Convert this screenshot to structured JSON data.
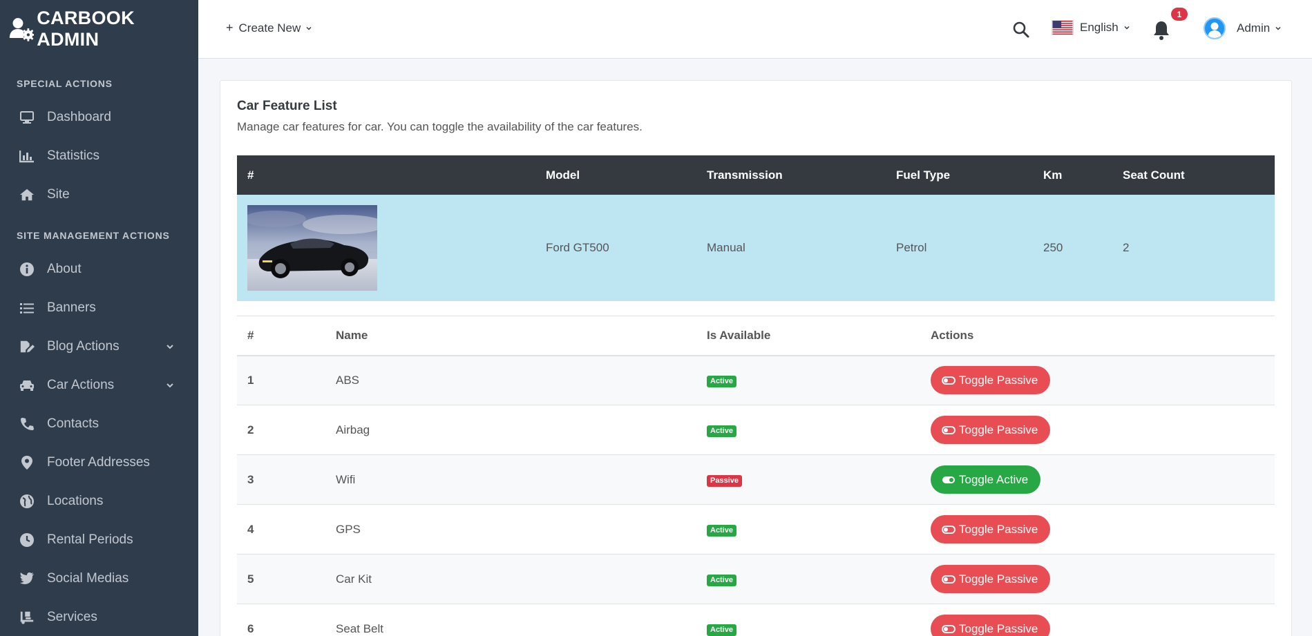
{
  "brand": {
    "title": "CARBOOK ADMIN"
  },
  "sidebar": {
    "sections": [
      {
        "header": "SPECIAL ACTIONS",
        "items": [
          {
            "label": "Dashboard",
            "icon": "desktop-icon"
          },
          {
            "label": "Statistics",
            "icon": "bar-chart-icon"
          },
          {
            "label": "Site",
            "icon": "home-icon"
          }
        ]
      },
      {
        "header": "SITE MANAGEMENT ACTIONS",
        "items": [
          {
            "label": "About",
            "icon": "info-icon"
          },
          {
            "label": "Banners",
            "icon": "list-icon"
          },
          {
            "label": "Blog Actions",
            "icon": "edit-icon",
            "expandable": true
          },
          {
            "label": "Car Actions",
            "icon": "car-icon",
            "expandable": true
          },
          {
            "label": "Contacts",
            "icon": "phone-icon"
          },
          {
            "label": "Footer Addresses",
            "icon": "map-marker-icon"
          },
          {
            "label": "Locations",
            "icon": "globe-icon"
          },
          {
            "label": "Rental Periods",
            "icon": "clock-icon"
          },
          {
            "label": "Social Medias",
            "icon": "twitter-icon"
          },
          {
            "label": "Services",
            "icon": "truck-loading-icon"
          }
        ]
      }
    ]
  },
  "topbar": {
    "create_new": "Create New",
    "language": "English",
    "notification_count": "1",
    "user": "Admin"
  },
  "card": {
    "title": "Car Feature List",
    "subtitle": "Manage car features for car. You can toggle the availability of the car features."
  },
  "car_table": {
    "headers": [
      "#",
      "Model",
      "Transmission",
      "Fuel Type",
      "Km",
      "Seat Count"
    ],
    "row": {
      "model": "Ford GT500",
      "transmission": "Manual",
      "fuel": "Petrol",
      "km": "250",
      "seats": "2"
    }
  },
  "features_table": {
    "headers": [
      "#",
      "Name",
      "Is Available",
      "Actions"
    ],
    "rows": [
      {
        "num": "1",
        "name": "ABS",
        "status": "Active",
        "action": "Toggle Passive"
      },
      {
        "num": "2",
        "name": "Airbag",
        "status": "Active",
        "action": "Toggle Passive"
      },
      {
        "num": "3",
        "name": "Wifi",
        "status": "Passive",
        "action": "Toggle Active"
      },
      {
        "num": "4",
        "name": "GPS",
        "status": "Active",
        "action": "Toggle Passive"
      },
      {
        "num": "5",
        "name": "Car Kit",
        "status": "Active",
        "action": "Toggle Passive"
      },
      {
        "num": "6",
        "name": "Seat Belt",
        "status": "Active",
        "action": "Toggle Passive"
      }
    ]
  },
  "colors": {
    "sidebar_bg": "#2f3c4b",
    "header_dark": "#343a40",
    "car_row_bg": "#bee5f2",
    "active_green": "#28a745",
    "passive_red": "#e84d53"
  }
}
